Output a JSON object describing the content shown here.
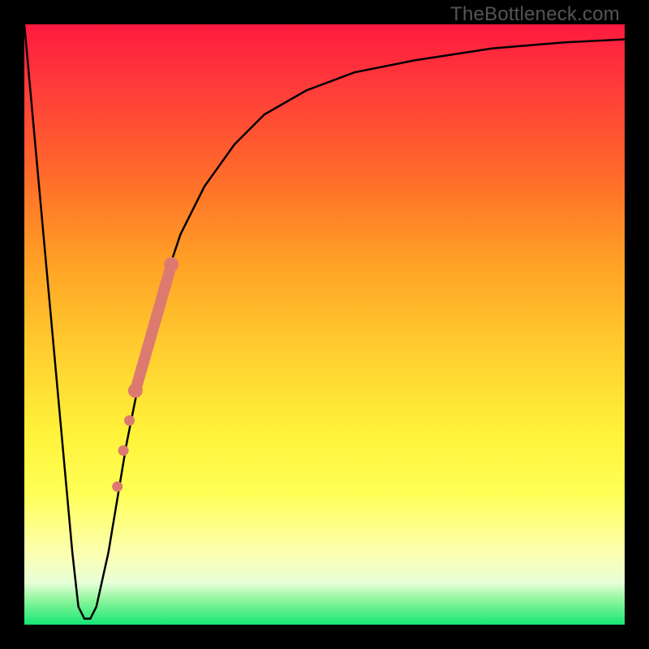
{
  "watermark": "TheBottleneck.com",
  "chart_data": {
    "type": "line",
    "title": "",
    "xlabel": "",
    "ylabel": "",
    "xlim": [
      0,
      100
    ],
    "ylim": [
      0,
      100
    ],
    "grid": false,
    "legend": false,
    "background": "vertical-gradient red→yellow→green",
    "series": [
      {
        "name": "bottleneck-curve",
        "color": "#000000",
        "x": [
          0,
          3,
          6,
          8,
          9,
          10,
          11,
          12,
          14,
          17,
          20,
          23,
          26,
          30,
          35,
          40,
          47,
          55,
          65,
          78,
          90,
          100
        ],
        "values": [
          100,
          67,
          34,
          12,
          3,
          1,
          1,
          3,
          12,
          30,
          45,
          56,
          65,
          73,
          80,
          85,
          89,
          92,
          94,
          96,
          97,
          97.5
        ]
      }
    ],
    "highlight_segment": {
      "name": "salmon-overlay",
      "color": "#dd7a70",
      "points": [
        {
          "x": 18.5,
          "y": 39
        },
        {
          "x": 24.5,
          "y": 60
        }
      ],
      "extra_dots": [
        {
          "x": 17.5,
          "y": 34
        },
        {
          "x": 16.5,
          "y": 29
        },
        {
          "x": 15.5,
          "y": 23
        }
      ]
    }
  }
}
